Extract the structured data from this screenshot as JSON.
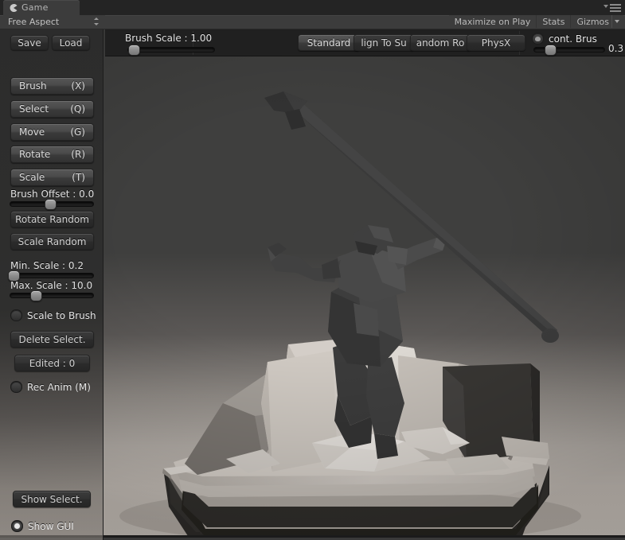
{
  "window": {
    "tab_label": "Game",
    "tab_icon": "pacman-game-icon",
    "aspect_value": "Free Aspect",
    "menu_icon": "hamburger-menu-icon",
    "toolbar_right": [
      {
        "label": "Maximize on Play",
        "name": "maximize-on-play-toggle"
      },
      {
        "label": "Stats",
        "name": "stats-toggle"
      },
      {
        "label": "Gizmos",
        "name": "gizmos-toggle"
      }
    ]
  },
  "top_overlay": {
    "brush_scale_label": "Brush Scale : 1.00",
    "brush_scale_value": 1.0,
    "brush_scale_pct": 6,
    "buttons": [
      {
        "label": "Standard",
        "name": "mode-standard-button",
        "state": "active"
      },
      {
        "label": "lign To Su",
        "name": "align-to-surface-button",
        "state": "normal"
      },
      {
        "label": "andom Ro",
        "name": "random-rotation-button",
        "state": "normal"
      },
      {
        "label": "PhysX",
        "name": "physx-button",
        "state": "normal"
      }
    ],
    "cont_brush_label": "cont. Brus",
    "cont_brush_checked": "half",
    "cont_brush_value": "0.3",
    "cont_brush_pct": 22
  },
  "sidebar": {
    "file_buttons": [
      {
        "label": "Save",
        "name": "save-button"
      },
      {
        "label": "Load",
        "name": "load-button"
      }
    ],
    "tools": [
      {
        "label": "Brush",
        "key": "(X)",
        "name": "tool-brush-button"
      },
      {
        "label": "Select",
        "key": "(Q)",
        "name": "tool-select-button"
      },
      {
        "label": "Move",
        "key": "(G)",
        "name": "tool-move-button"
      },
      {
        "label": "Rotate",
        "key": "(R)",
        "name": "tool-rotate-button"
      },
      {
        "label": "Scale",
        "key": "(T)",
        "name": "tool-scale-button"
      }
    ],
    "brush_offset_label": "Brush Offset : 0.0",
    "brush_offset_pct": 47,
    "rotate_random_label": "Rotate Random",
    "scale_random_label": "Scale Random",
    "min_scale_label": "Min. Scale : 0.2",
    "min_scale_pct": 4,
    "max_scale_label": "Max. Scale : 10.0",
    "max_scale_pct": 30,
    "scale_to_brush_label": "Scale to Brush",
    "scale_to_brush_checked": "off",
    "delete_select_label": "Delete Select.",
    "edited_label": "Edited : 0",
    "rec_anim_label": "Rec Anim (M)",
    "rec_anim_checked": "off",
    "show_select_label": "Show Select.",
    "show_gui_label": "Show GUI",
    "show_gui_checked": "on"
  },
  "scene": {
    "description": "low-poly dark statue of a spear-throwing figure on a light stone pedestal",
    "background_top": "#3f3f3e",
    "background_bottom": "#c7c0b9",
    "statue_color": "#3a3a3a",
    "pedestal_color": "#cfc9c2"
  }
}
